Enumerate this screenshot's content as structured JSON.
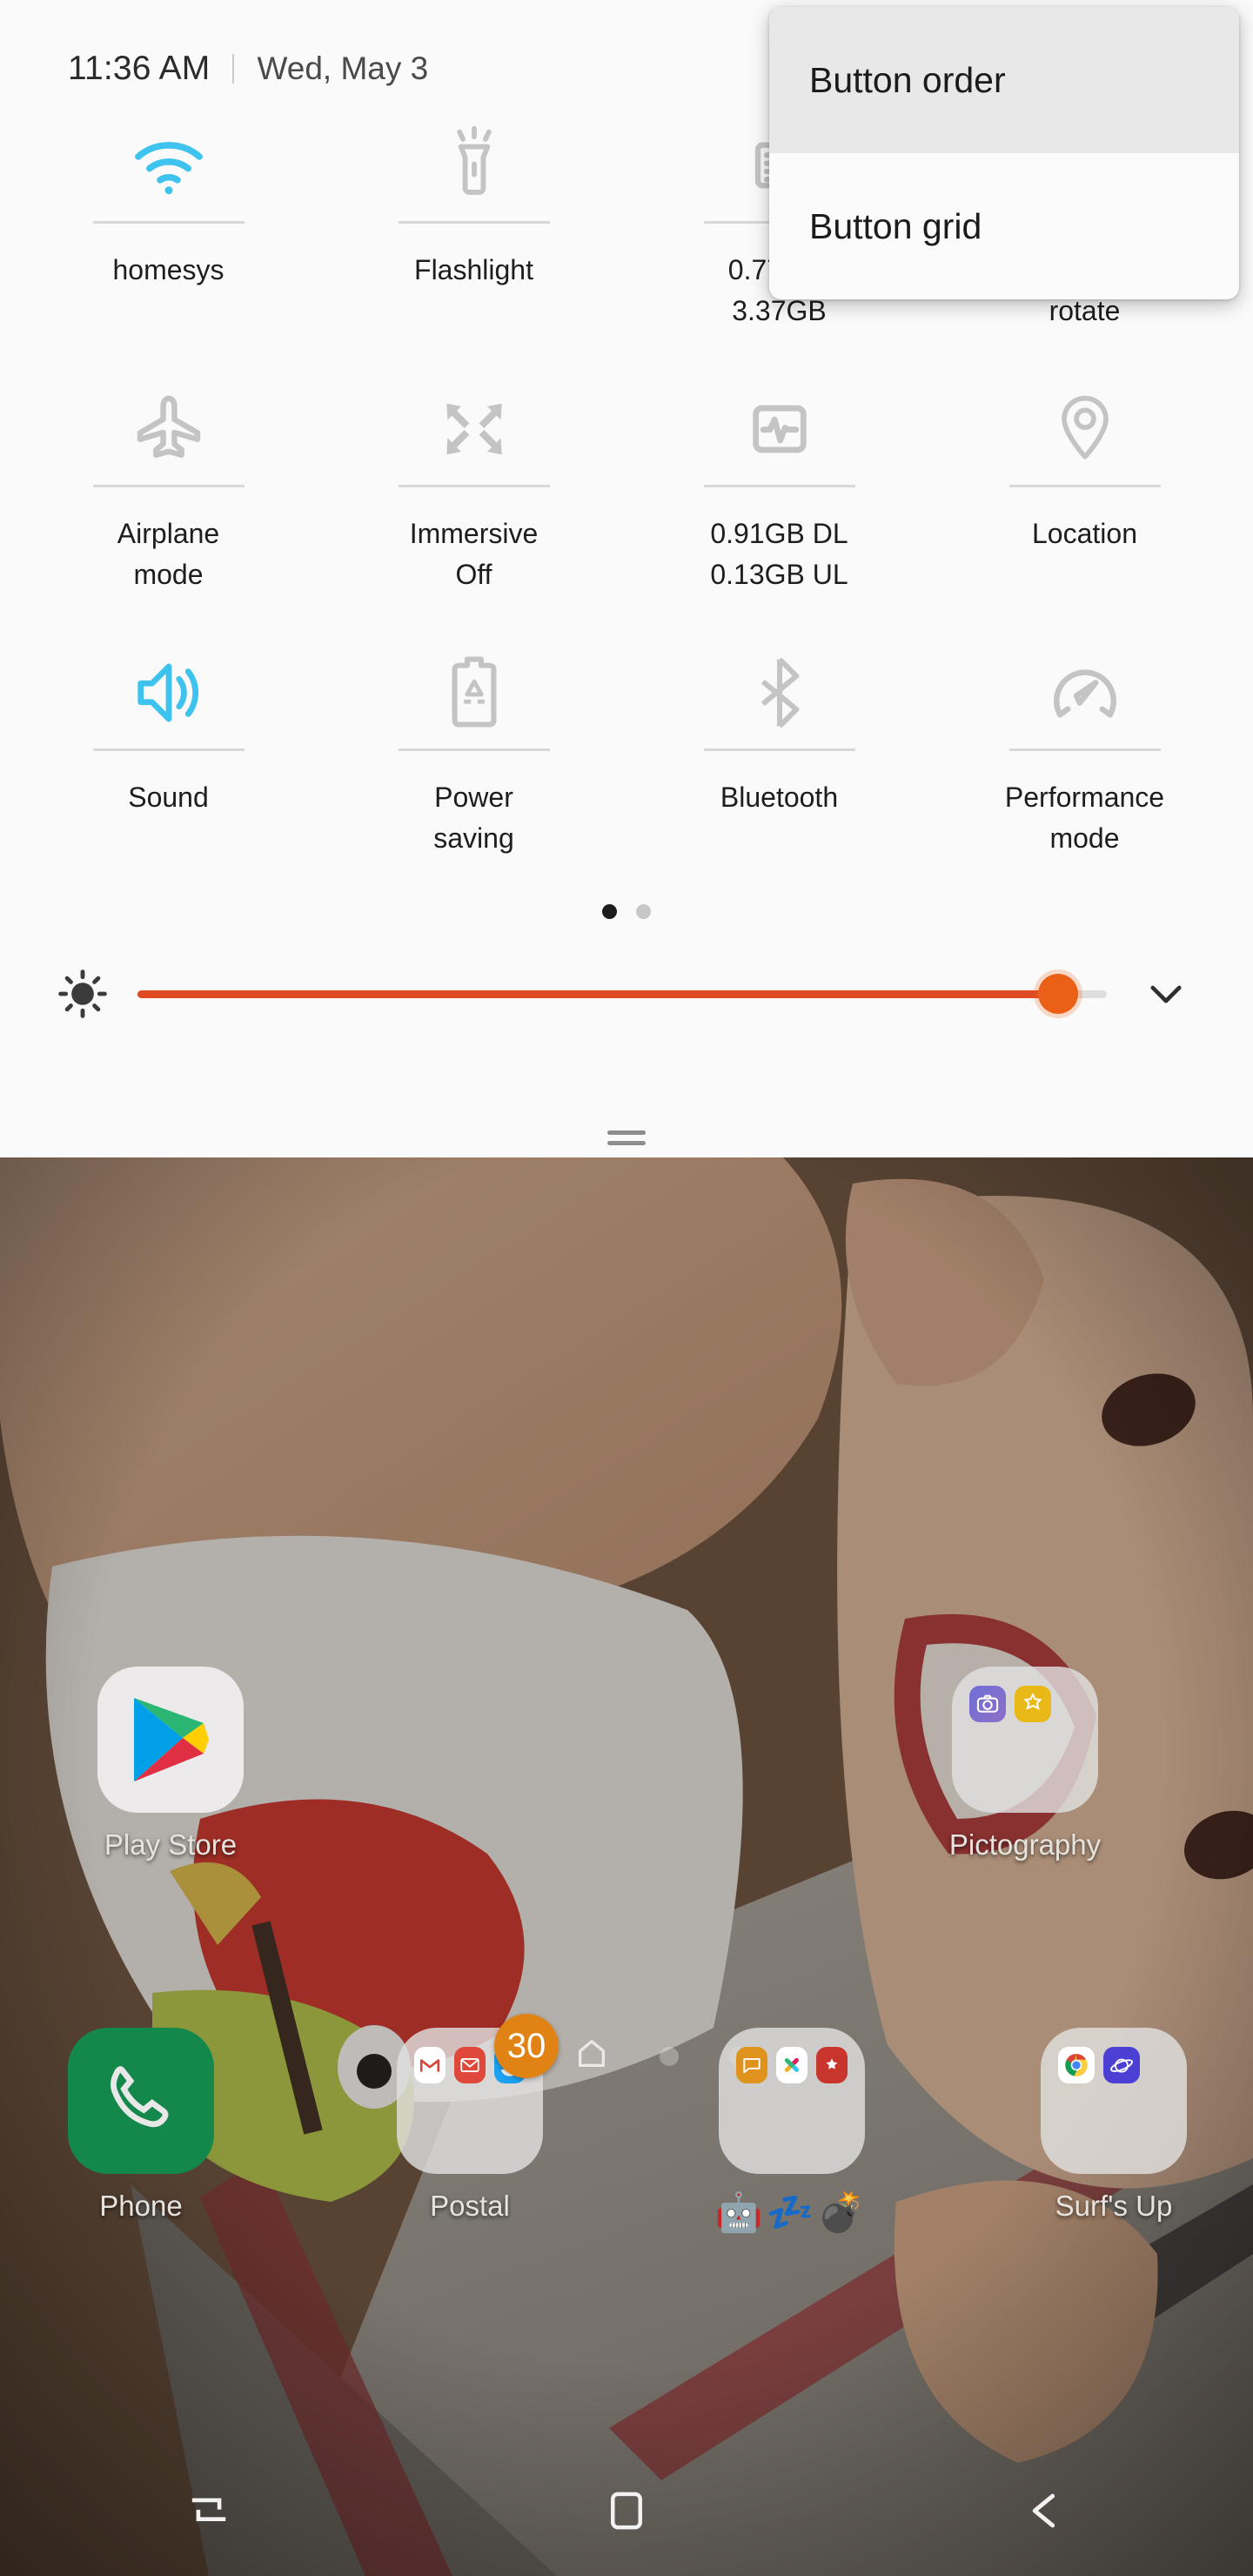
{
  "status": {
    "time": "11:36 AM",
    "date": "Wed, May 3"
  },
  "colors": {
    "accent_active": "#3ec2ee",
    "accent_inactive": "#c4c4c4",
    "brightness_fill": "#e04a23",
    "brightness_thumb": "#ea6017",
    "badge": "#e08314",
    "panel_bg": "#fafafa",
    "popup_bg": "#fbfbfb",
    "popup_pressed_bg": "#e8e8e8"
  },
  "popup_menu": {
    "items": [
      {
        "label": "Button order",
        "icon": "button-order",
        "pressed": true
      },
      {
        "label": "Button grid",
        "icon": "button-grid",
        "pressed": false
      }
    ]
  },
  "quick_settings": {
    "tiles": [
      {
        "label": "homesys",
        "icon": "wifi-icon",
        "active": true
      },
      {
        "label": "Flashlight",
        "icon": "flashlight-icon",
        "active": false
      },
      {
        "label": "0.77GB/\n3.37GB",
        "icon": "ram-meter-icon",
        "active": false
      },
      {
        "label": "Auto\nrotate",
        "icon": "auto-rotate-icon",
        "active": false
      },
      {
        "label": "Airplane\nmode",
        "icon": "airplane-icon",
        "active": false
      },
      {
        "label": "Immersive\nOff",
        "icon": "immersive-icon",
        "active": false
      },
      {
        "label": "0.91GB DL\n0.13GB UL",
        "icon": "data-usage-icon",
        "active": false
      },
      {
        "label": "Location",
        "icon": "location-pin-icon",
        "active": false
      },
      {
        "label": "Sound",
        "icon": "sound-icon",
        "active": true
      },
      {
        "label": "Power\nsaving",
        "icon": "power-saving-icon",
        "active": false
      },
      {
        "label": "Bluetooth",
        "icon": "bluetooth-icon",
        "active": false
      },
      {
        "label": "Performance\nmode",
        "icon": "performance-icon",
        "active": false
      }
    ],
    "page_dots": {
      "count": 2,
      "active_index": 0
    },
    "brightness": {
      "icon": "brightness-icon",
      "value_percent": 95,
      "expand_icon": "chevron-down-icon"
    },
    "drag_handle": "panel-drag-handle"
  },
  "home_screen": {
    "apps": [
      {
        "name": "Play Store",
        "type": "app",
        "icon": "play-store-icon"
      },
      {
        "name": "Pictography",
        "type": "folder",
        "icon": "folder-icon",
        "minis": [
          "camera-icon",
          "photo-editor-icon"
        ]
      }
    ],
    "page_dots": {
      "count": 4,
      "home_index": 1
    },
    "dock": [
      {
        "name": "Phone",
        "type": "app",
        "icon": "phone-icon"
      },
      {
        "name": "Postal",
        "type": "folder",
        "icon": "folder-icon",
        "minis": [
          "gmail-icon",
          "email-icon",
          "twitter-icon"
        ],
        "badge": "30"
      },
      {
        "name": "🤖💤💣",
        "type": "folder",
        "icon": "folder-icon",
        "minis": [
          "messages-icon",
          "slack-icon",
          "wunderlist-icon"
        ]
      },
      {
        "name": "Surf's Up",
        "type": "folder",
        "icon": "folder-icon",
        "minis": [
          "chrome-icon",
          "samsung-internet-icon"
        ]
      }
    ],
    "navbar": [
      {
        "icon": "recents-icon",
        "label": "Recents"
      },
      {
        "icon": "home-icon",
        "label": "Home"
      },
      {
        "icon": "back-icon",
        "label": "Back"
      }
    ]
  }
}
